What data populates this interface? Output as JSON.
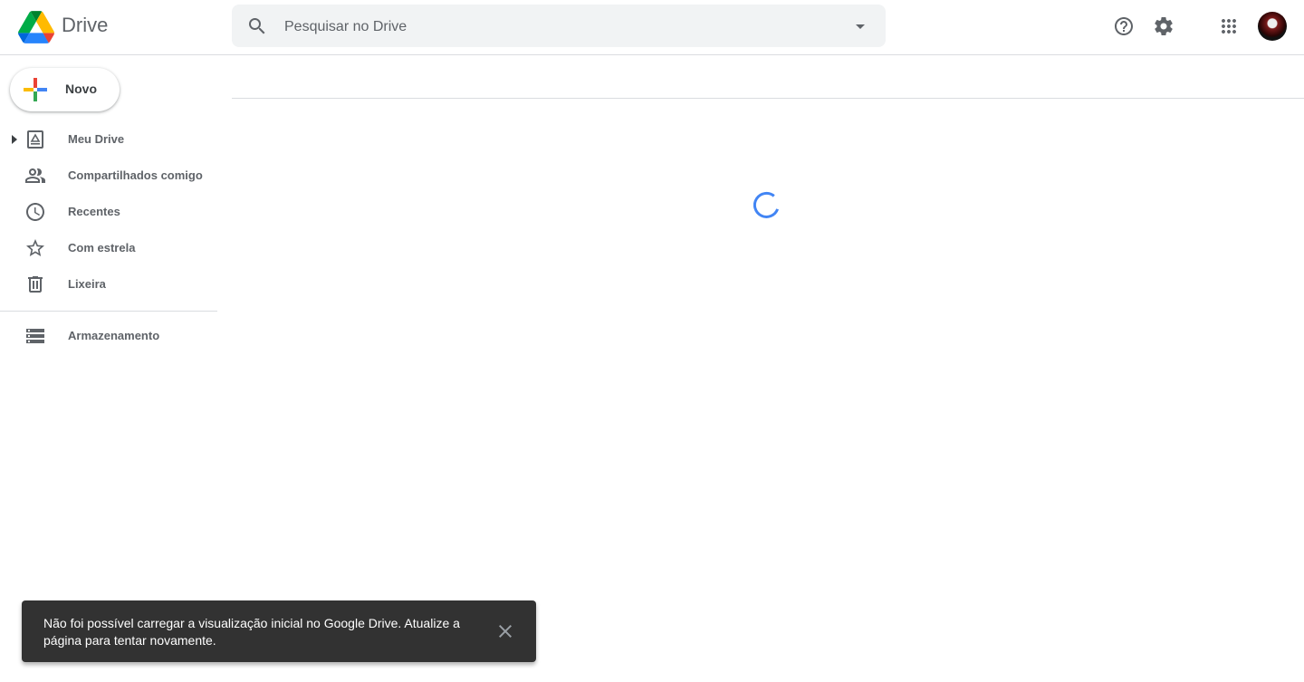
{
  "header": {
    "app_name": "Drive",
    "search_placeholder": "Pesquisar no Drive",
    "icons": [
      "search-icon",
      "search-options-icon",
      "help-icon",
      "settings-icon",
      "apps-icon",
      "avatar"
    ]
  },
  "sidebar": {
    "new_label": "Novo",
    "items": [
      {
        "label": "Meu Drive",
        "icon": "my-drive-icon"
      },
      {
        "label": "Compartilhados comigo",
        "icon": "shared-people-icon"
      },
      {
        "label": "Recentes",
        "icon": "clock-icon"
      },
      {
        "label": "Com estrela",
        "icon": "star-icon"
      },
      {
        "label": "Lixeira",
        "icon": "trash-icon"
      }
    ],
    "storage_label": "Armazenamento"
  },
  "main": {
    "loading": true
  },
  "snackbar": {
    "message": "Não foi possível carregar a visualização inicial no Google Drive. Atualize a página para tentar novamente."
  },
  "colors": {
    "google_blue": "#4285f4",
    "google_red": "#ea4335",
    "google_yellow": "#fbbc04",
    "google_green": "#34a853",
    "icon_gray": "#5f6368",
    "snackbar_bg": "#323232"
  }
}
